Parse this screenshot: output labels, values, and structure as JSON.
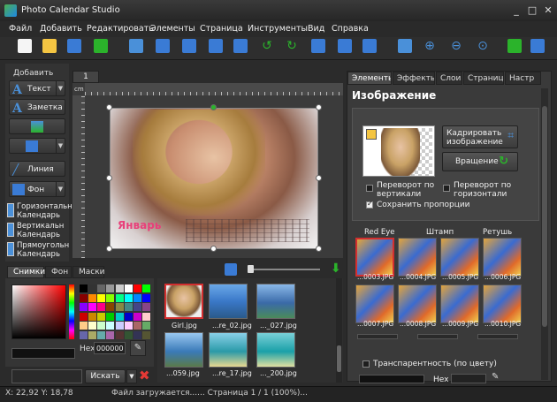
{
  "window": {
    "title": "Photo Calendar Studio",
    "minimize": "_",
    "maximize": "□",
    "close": "✕"
  },
  "menu": [
    "Файл",
    "Добавить",
    "Редактировать",
    "Элементы",
    "Страница",
    "Инструменты",
    "Вид",
    "Справка"
  ],
  "left_panel": {
    "title": "Добавить",
    "text_btn": "Текст",
    "note_btn": "Заметка",
    "line_btn": "Линия",
    "bg_btn": "Фон",
    "calendars": [
      "Горизонтальн Календарь",
      "Вертикальн Календарь",
      "Прямоугольн Календарь"
    ]
  },
  "canvas": {
    "page_tab": "1",
    "ruler_unit": "cm",
    "month": "Январь"
  },
  "right_panel": {
    "tabs": [
      "Элементы",
      "Эффекты",
      "Слои",
      "Страница",
      "Настр"
    ],
    "section_title": "Изображение",
    "crop_btn": "Кадрировать изображение",
    "rotate_btn": "Вращение",
    "flip_v": "Переворот по вертикали",
    "flip_h": "Переворот по горизонтали",
    "keep_ratio": "Сохранить пропорции",
    "effect_groups": [
      "Red Eye",
      "Штамп",
      "Ретушь"
    ],
    "effects_row1": [
      "...0003.JPG",
      "...0004.JPG",
      "...0005.JPG",
      "...0006.JPG"
    ],
    "effects_row2": [
      "...0007.JPG",
      "...0008.JPG",
      "...0009.JPG",
      "...0010.JPG"
    ],
    "transparency": "Транспарентность (по цвету)",
    "hex_label": "Hex"
  },
  "bottom_panel": {
    "tabs": [
      "Снимки",
      "Фон",
      "Маски"
    ],
    "hex_label": "Hex",
    "hex_value": "000000",
    "search_btn": "Искать",
    "files": [
      "Girl.jpg",
      "...re_02.jpg",
      "..._027.jpg",
      "...059.jpg",
      "...re_17.jpg",
      "..._200.jpg"
    ]
  },
  "status": {
    "coords": "X: 22,92 Y: 18,78",
    "message": "Файл загружается...... Страница 1 / 1 (100%)..."
  },
  "colors": {
    "accent_green": "#2bb32b",
    "selection_red": "#d32f2f",
    "month_pink": "#e8407a"
  }
}
